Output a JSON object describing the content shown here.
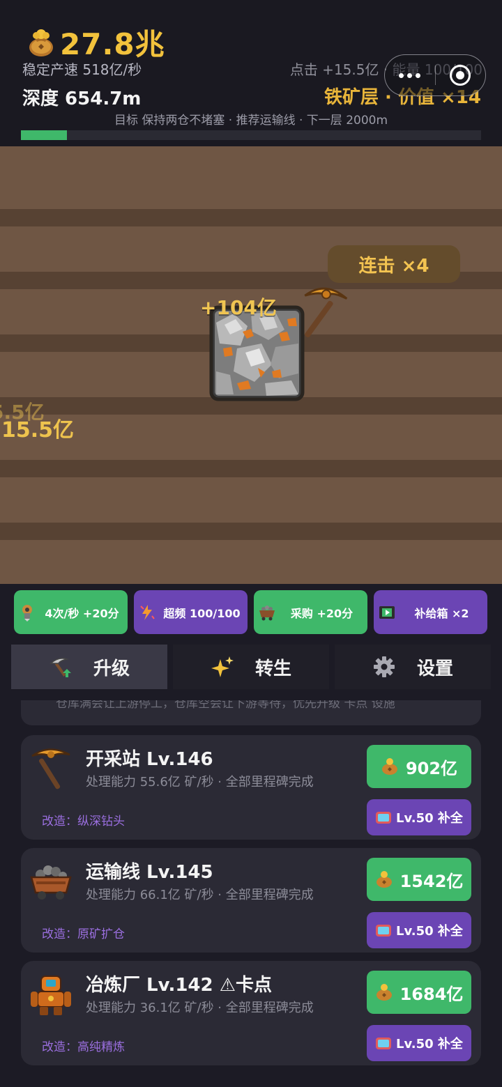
{
  "header": {
    "coins": "27.8兆",
    "rate": "稳定产速 518亿/秒",
    "tap_info": "点击 +15.5亿 · 能量 100/100",
    "depth": "深度 654.7m",
    "layer": "铁矿层 · 价值 ×14",
    "goal": "目标 保持两仓不堵塞 · 推荐运输线 · 下一层 2000m",
    "depth_progress": 0.1
  },
  "mine": {
    "combo": "连击 ×4",
    "float_main": "+104亿",
    "float_ghost": "5.5亿",
    "float_side": "15.5亿"
  },
  "boosts": [
    {
      "label": "4次/秒 +20分",
      "icon": "drill-robot-icon",
      "color": "green"
    },
    {
      "label": "超频 100/100",
      "icon": "lightning-icon",
      "color": "purple"
    },
    {
      "label": "采购 +20分",
      "icon": "mine-cart-icon",
      "color": "green"
    },
    {
      "label": "补给箱 ×2",
      "icon": "video-icon",
      "color": "purple"
    }
  ],
  "tabs": [
    {
      "label": "升级",
      "icon": "pickaxe-upgrade-icon",
      "active": true
    },
    {
      "label": "转生",
      "icon": "sparkle-icon",
      "active": false
    },
    {
      "label": "设置",
      "icon": "gear-icon",
      "active": false
    }
  ],
  "partial_tip": "仓库满会让上游停工，仓库空会让下游等待，优先升级 卡点 设施",
  "facilities": [
    {
      "title": "开采站 Lv.146",
      "desc": "处理能力 55.6亿 矿/秒 · 全部里程碑完成",
      "mod": "改造：纵深钻头",
      "cost": "902亿",
      "ad": "Lv.50 补全",
      "icon": "pickaxe-icon"
    },
    {
      "title": "运输线 Lv.145",
      "desc": "处理能力 66.1亿 矿/秒 · 全部里程碑完成",
      "mod": "改造：原矿扩仓",
      "cost": "1542亿",
      "ad": "Lv.50 补全",
      "icon": "ore-cart-icon"
    },
    {
      "title": "冶炼厂 Lv.142 ⚠卡点",
      "desc": "处理能力 36.1亿 矿/秒 · 全部里程碑完成",
      "mod": "改造：高纯精炼",
      "cost": "1684亿",
      "ad": "Lv.50 补全",
      "icon": "robot-icon"
    }
  ],
  "colors": {
    "gold": "#f2c23c",
    "green": "#3fb86a",
    "purple": "#6b45b4",
    "background": "#1c1b25"
  }
}
